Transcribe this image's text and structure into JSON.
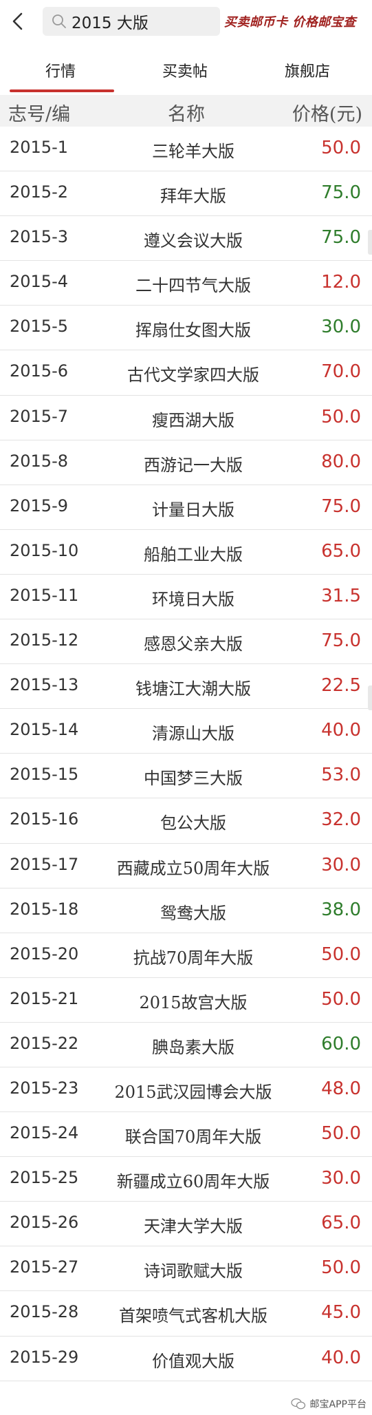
{
  "search": {
    "query": "2015 大版"
  },
  "promo": "买卖邮币卡 价格邮宝查",
  "tabs": [
    {
      "label": "行情"
    },
    {
      "label": "买卖帖"
    },
    {
      "label": "旗舰店"
    }
  ],
  "table": {
    "headers": [
      "志号/编",
      "名称",
      "价格(元)"
    ],
    "rows": [
      {
        "code": "2015-1",
        "name": "三轮羊大版",
        "price": "50.0",
        "trend": "up"
      },
      {
        "code": "2015-2",
        "name": "拜年大版",
        "price": "75.0",
        "trend": "down"
      },
      {
        "code": "2015-3",
        "name": "遵义会议大版",
        "price": "75.0",
        "trend": "down"
      },
      {
        "code": "2015-4",
        "name": "二十四节气大版",
        "price": "12.0",
        "trend": "up"
      },
      {
        "code": "2015-5",
        "name": "挥扇仕女图大版",
        "price": "30.0",
        "trend": "down"
      },
      {
        "code": "2015-6",
        "name": "古代文学家四大版",
        "price": "70.0",
        "trend": "up"
      },
      {
        "code": "2015-7",
        "name": "瘦西湖大版",
        "price": "50.0",
        "trend": "up"
      },
      {
        "code": "2015-8",
        "name": "西游记一大版",
        "price": "80.0",
        "trend": "up"
      },
      {
        "code": "2015-9",
        "name": "计量日大版",
        "price": "75.0",
        "trend": "up"
      },
      {
        "code": "2015-10",
        "name": "船舶工业大版",
        "price": "65.0",
        "trend": "up"
      },
      {
        "code": "2015-11",
        "name": "环境日大版",
        "price": "31.5",
        "trend": "up"
      },
      {
        "code": "2015-12",
        "name": "感恩父亲大版",
        "price": "75.0",
        "trend": "up"
      },
      {
        "code": "2015-13",
        "name": "钱塘江大潮大版",
        "price": "22.5",
        "trend": "up"
      },
      {
        "code": "2015-14",
        "name": "清源山大版",
        "price": "40.0",
        "trend": "up"
      },
      {
        "code": "2015-15",
        "name": "中国梦三大版",
        "price": "53.0",
        "trend": "up"
      },
      {
        "code": "2015-16",
        "name": "包公大版",
        "price": "32.0",
        "trend": "up"
      },
      {
        "code": "2015-17",
        "name": "西藏成立50周年大版",
        "price": "30.0",
        "trend": "up"
      },
      {
        "code": "2015-18",
        "name": "鸳鸯大版",
        "price": "38.0",
        "trend": "down"
      },
      {
        "code": "2015-20",
        "name": "抗战70周年大版",
        "price": "50.0",
        "trend": "up"
      },
      {
        "code": "2015-21",
        "name": "2015故宫大版",
        "price": "50.0",
        "trend": "up"
      },
      {
        "code": "2015-22",
        "name": "腆岛素大版",
        "price": "60.0",
        "trend": "down"
      },
      {
        "code": "2015-23",
        "name": "2015武汉园博会大版",
        "price": "48.0",
        "trend": "up"
      },
      {
        "code": "2015-24",
        "name": "联合国70周年大版",
        "price": "50.0",
        "trend": "up"
      },
      {
        "code": "2015-25",
        "name": "新疆成立60周年大版",
        "price": "30.0",
        "trend": "up"
      },
      {
        "code": "2015-26",
        "name": "天津大学大版",
        "price": "65.0",
        "trend": "up"
      },
      {
        "code": "2015-27",
        "name": "诗词歌赋大版",
        "price": "50.0",
        "trend": "up"
      },
      {
        "code": "2015-28",
        "name": "首架喷气式客机大版",
        "price": "45.0",
        "trend": "up"
      },
      {
        "code": "2015-29",
        "name": "价值观大版",
        "price": "40.0",
        "trend": "up"
      }
    ]
  },
  "colors": {
    "up": "#c8322e",
    "down": "#2f7d2c",
    "accent": "#c8322e"
  },
  "icons": {
    "back": "chevron-left-icon",
    "search": "search-icon",
    "watermark": "wechat-icon"
  },
  "watermark": "邮宝APP平台"
}
